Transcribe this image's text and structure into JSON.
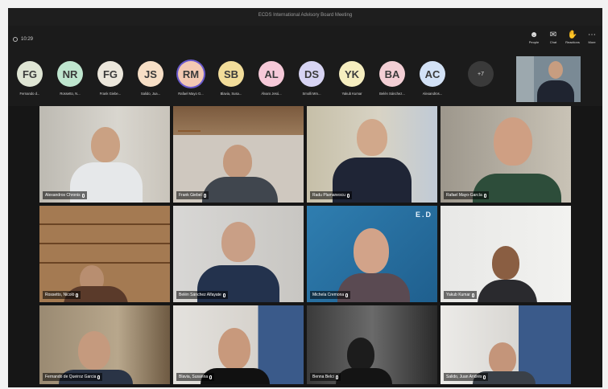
{
  "window": {
    "title": "ECDS International Advisory Board Meeting"
  },
  "toolbar": {
    "timer": "10:29",
    "people_label": "People",
    "chat_label": "Chat",
    "reactions_label": "Reactions",
    "more_label": "More",
    "people_icon": "people-icon",
    "chat_icon": "chat-icon",
    "reactions_icon": "reactions-icon",
    "more_icon": "more-icon"
  },
  "roster": {
    "participants": [
      {
        "initials": "FG",
        "name": "Fernando d...",
        "color": "#dfe5d4"
      },
      {
        "initials": "NR",
        "name": "Rossetto, N...",
        "color": "#bfe6cf"
      },
      {
        "initials": "FG",
        "name": "Frank Giebe...",
        "color": "#ece7dc"
      },
      {
        "initials": "JS",
        "name": "Salido, Jua...",
        "color": "#f7dfc6"
      },
      {
        "initials": "RM",
        "name": "Rafael Mayo G...",
        "color": "#f3c9b3"
      },
      {
        "initials": "SB",
        "name": "Blavia, Susa...",
        "color": "#f2dd9a"
      },
      {
        "initials": "AL",
        "name": "Álvaro Jesú...",
        "color": "#f6c9d8"
      },
      {
        "initials": "DS",
        "name": "Smolli Mm...",
        "color": "#d7d4f3"
      },
      {
        "initials": "YK",
        "name": "Yakub Kumar",
        "color": "#f6eec0"
      },
      {
        "initials": "BA",
        "name": "Belén Sánchez...",
        "color": "#f3cfd5"
      },
      {
        "initials": "AC",
        "name": "Alexandros...",
        "color": "#d3e2f6"
      }
    ],
    "more_count": "+7"
  },
  "tiles": [
    {
      "name": "Alexandros Chronis"
    },
    {
      "name": "Frank Giebel"
    },
    {
      "name": "Radu Plamanescu"
    },
    {
      "name": "Rafael Mayo-García"
    },
    {
      "name": "Rossetto, Nicolò"
    },
    {
      "name": "Belén Sánchez Alfayate"
    },
    {
      "name": "Michela Cremona"
    },
    {
      "name": "Yakub Kumar"
    },
    {
      "name": "Fernando de Queiroz Garcia"
    },
    {
      "name": "Blavia, Susanna"
    },
    {
      "name": "Benna Belci"
    },
    {
      "name": "Salido, Juan Andrés"
    }
  ],
  "michela_logo": "E.D"
}
